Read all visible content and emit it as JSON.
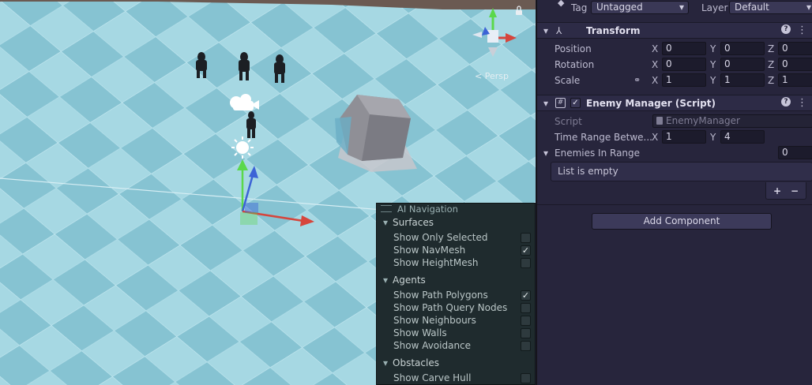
{
  "scene": {
    "persp_label": "< Persp",
    "lock_icon": "lock-icon",
    "colors": {
      "floor_light": "#a3d6e1",
      "floor_dark": "#7ebbcb",
      "gizmo_x": "#d6453c",
      "gizmo_y": "#5bd84b",
      "gizmo_z": "#3c63d6"
    }
  },
  "inspector": {
    "tag_label": "Tag",
    "tag_value": "Untagged",
    "layer_label": "Layer",
    "layer_value": "Default",
    "transform": {
      "title": "Transform",
      "position": {
        "label": "Position",
        "x": "0",
        "y": "0",
        "z": "0"
      },
      "rotation": {
        "label": "Rotation",
        "x": "0",
        "y": "0",
        "z": "0"
      },
      "scale": {
        "label": "Scale",
        "x": "1",
        "y": "1",
        "z": "1"
      }
    },
    "enemy_manager": {
      "title": "Enemy Manager (Script)",
      "script_label": "Script",
      "script_value": "EnemyManager",
      "time_range_label": "Time Range Betwe...",
      "time_range_x": "1",
      "time_range_y": "4",
      "enemies_label": "Enemies In Range",
      "enemies_count": "0",
      "list_empty": "List is empty",
      "plus": "+",
      "minus": "−"
    },
    "add_component": "Add Component",
    "axis_x": "X",
    "axis_y": "Y",
    "axis_z": "Z"
  },
  "ai_navigation": {
    "title": "AI Navigation",
    "sections": [
      {
        "label": "Surfaces",
        "options": [
          {
            "label": "Show Only Selected",
            "checked": false
          },
          {
            "label": "Show NavMesh",
            "checked": true
          },
          {
            "label": "Show HeightMesh",
            "checked": false
          }
        ]
      },
      {
        "label": "Agents",
        "options": [
          {
            "label": "Show Path Polygons",
            "checked": true
          },
          {
            "label": "Show Path Query Nodes",
            "checked": false
          },
          {
            "label": "Show Neighbours",
            "checked": false
          },
          {
            "label": "Show Walls",
            "checked": false
          },
          {
            "label": "Show Avoidance",
            "checked": false
          }
        ]
      },
      {
        "label": "Obstacles",
        "options": [
          {
            "label": "Show Carve Hull",
            "checked": false
          }
        ]
      }
    ]
  }
}
